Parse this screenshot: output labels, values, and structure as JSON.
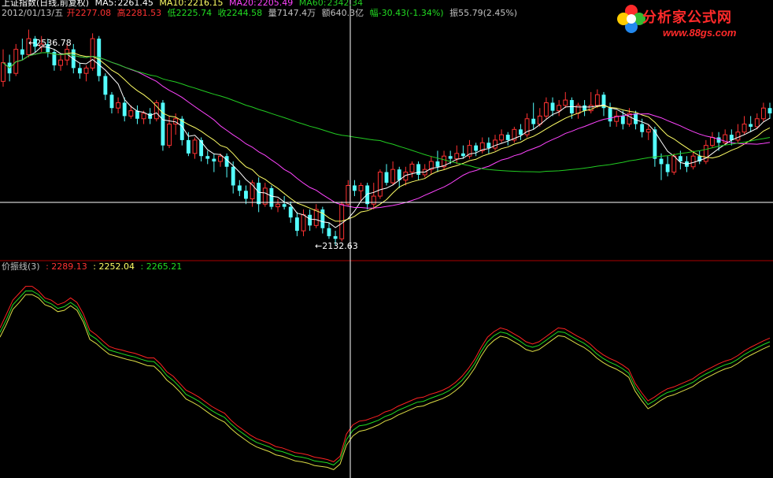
{
  "header": {
    "index_name": "上证指数",
    "period": "(日线,前复权)",
    "ma5_label": "MA5:",
    "ma5_value": "2261.45",
    "ma10_label": "MA10:",
    "ma10_value": "2216.15",
    "ma20_label": "MA20:",
    "ma20_value": "2205.49",
    "ma60_label": "MA60:",
    "ma60_value": "2342.34"
  },
  "info": {
    "date": "2012/01/13/五",
    "open_label": "开",
    "open_value": "2277.08",
    "high_label": "高",
    "high_value": "2281.53",
    "low_label": "低",
    "low_value": "2225.74",
    "close_label": "收",
    "close_value": "2244.58",
    "volume_label": "量",
    "volume_value": "7147.4万",
    "amount_label": "额",
    "amount_value": "640.3亿",
    "change_label": "幅",
    "change_value": "-30.43(-1.34%)",
    "amplitude_label": "振",
    "amplitude_value": "55.79(2.45%)"
  },
  "price_marks": {
    "high": "2536.78",
    "low": "2132.63"
  },
  "indicator": {
    "name": "价振线(3)",
    "v1": ": 2289.13",
    "v2": ": 2252.04",
    "v3": ": 2265.21"
  },
  "logo": {
    "text": "分析家公式网",
    "url": "www.88gs.com"
  },
  "colors": {
    "up": "#ff3232",
    "down": "#54ffff",
    "ma5": "#ffffff",
    "ma10": "#ffff66",
    "ma20": "#ff44ff",
    "ma60": "#22cc22",
    "line1": "#ff2222",
    "line2": "#22dd22",
    "line3": "#dddd44",
    "crosshair": "#ffffff",
    "divider": "#aa0000",
    "text": "#c0c0c0"
  },
  "chart_data": [
    {
      "type": "candlestick",
      "title": "上证指数 (日线,前复权)",
      "ylim": [
        2110,
        2560
      ],
      "extremes": {
        "high": 2536.78,
        "low": 2132.63
      },
      "ohlc": [
        [
          2440,
          2475,
          2500,
          2430
        ],
        [
          2475,
          2455,
          2490,
          2440
        ],
        [
          2455,
          2500,
          2510,
          2450
        ],
        [
          2500,
          2490,
          2520,
          2480
        ],
        [
          2490,
          2520,
          2537,
          2485
        ],
        [
          2520,
          2505,
          2525,
          2495
        ],
        [
          2505,
          2510,
          2525,
          2495
        ],
        [
          2510,
          2495,
          2520,
          2485
        ],
        [
          2495,
          2470,
          2500,
          2460
        ],
        [
          2470,
          2480,
          2490,
          2460
        ],
        [
          2480,
          2500,
          2510,
          2470
        ],
        [
          2500,
          2465,
          2510,
          2455
        ],
        [
          2465,
          2455,
          2475,
          2445
        ],
        [
          2455,
          2465,
          2470,
          2440
        ],
        [
          2465,
          2520,
          2530,
          2460
        ],
        [
          2520,
          2450,
          2525,
          2440
        ],
        [
          2450,
          2415,
          2455,
          2405
        ],
        [
          2415,
          2390,
          2420,
          2380
        ],
        [
          2390,
          2400,
          2410,
          2380
        ],
        [
          2400,
          2375,
          2410,
          2365
        ],
        [
          2375,
          2385,
          2395,
          2370
        ],
        [
          2385,
          2370,
          2395,
          2360
        ],
        [
          2370,
          2380,
          2385,
          2360
        ],
        [
          2380,
          2370,
          2390,
          2360
        ],
        [
          2370,
          2400,
          2405,
          2365
        ],
        [
          2400,
          2320,
          2405,
          2310
        ],
        [
          2320,
          2360,
          2375,
          2315
        ],
        [
          2360,
          2370,
          2380,
          2340
        ],
        [
          2370,
          2330,
          2375,
          2320
        ],
        [
          2330,
          2305,
          2345,
          2300
        ],
        [
          2305,
          2330,
          2335,
          2295
        ],
        [
          2330,
          2300,
          2335,
          2290
        ],
        [
          2300,
          2295,
          2310,
          2285
        ],
        [
          2295,
          2290,
          2305,
          2270
        ],
        [
          2290,
          2300,
          2305,
          2280
        ],
        [
          2300,
          2280,
          2305,
          2260
        ],
        [
          2280,
          2245,
          2290,
          2230
        ],
        [
          2245,
          2235,
          2255,
          2225
        ],
        [
          2235,
          2220,
          2245,
          2210
        ],
        [
          2220,
          2250,
          2255,
          2205
        ],
        [
          2250,
          2210,
          2260,
          2195
        ],
        [
          2210,
          2240,
          2250,
          2205
        ],
        [
          2240,
          2205,
          2245,
          2200
        ],
        [
          2205,
          2210,
          2220,
          2195
        ],
        [
          2210,
          2205,
          2225,
          2200
        ],
        [
          2205,
          2185,
          2215,
          2175
        ],
        [
          2185,
          2160,
          2195,
          2150
        ],
        [
          2160,
          2190,
          2200,
          2150
        ],
        [
          2190,
          2170,
          2200,
          2160
        ],
        [
          2170,
          2200,
          2210,
          2165
        ],
        [
          2200,
          2165,
          2205,
          2155
        ],
        [
          2165,
          2150,
          2175,
          2145
        ],
        [
          2150,
          2145,
          2160,
          2133
        ],
        [
          2145,
          2210,
          2215,
          2140
        ],
        [
          2210,
          2245,
          2255,
          2205
        ],
        [
          2245,
          2235,
          2255,
          2225
        ],
        [
          2235,
          2245,
          2250,
          2215
        ],
        [
          2245,
          2210,
          2250,
          2200
        ],
        [
          2210,
          2225,
          2250,
          2200
        ],
        [
          2225,
          2270,
          2275,
          2220
        ],
        [
          2270,
          2250,
          2285,
          2245
        ],
        [
          2250,
          2275,
          2290,
          2245
        ],
        [
          2275,
          2255,
          2280,
          2240
        ],
        [
          2255,
          2270,
          2280,
          2245
        ],
        [
          2270,
          2285,
          2290,
          2260
        ],
        [
          2285,
          2265,
          2290,
          2255
        ],
        [
          2265,
          2275,
          2285,
          2260
        ],
        [
          2275,
          2290,
          2300,
          2265
        ],
        [
          2290,
          2280,
          2310,
          2270
        ],
        [
          2280,
          2300,
          2310,
          2275
        ],
        [
          2300,
          2295,
          2310,
          2285
        ],
        [
          2295,
          2305,
          2320,
          2285
        ],
        [
          2305,
          2300,
          2320,
          2295
        ],
        [
          2300,
          2320,
          2330,
          2295
        ],
        [
          2320,
          2310,
          2325,
          2300
        ],
        [
          2310,
          2325,
          2335,
          2305
        ],
        [
          2325,
          2315,
          2335,
          2305
        ],
        [
          2315,
          2330,
          2340,
          2310
        ],
        [
          2330,
          2340,
          2350,
          2325
        ],
        [
          2340,
          2330,
          2345,
          2320
        ],
        [
          2330,
          2350,
          2355,
          2325
        ],
        [
          2350,
          2340,
          2360,
          2330
        ],
        [
          2340,
          2370,
          2380,
          2335
        ],
        [
          2370,
          2360,
          2400,
          2350
        ],
        [
          2360,
          2375,
          2390,
          2355
        ],
        [
          2375,
          2400,
          2410,
          2370
        ],
        [
          2400,
          2385,
          2410,
          2375
        ],
        [
          2385,
          2395,
          2405,
          2375
        ],
        [
          2395,
          2405,
          2420,
          2390
        ],
        [
          2405,
          2380,
          2410,
          2370
        ],
        [
          2380,
          2395,
          2400,
          2370
        ],
        [
          2395,
          2385,
          2405,
          2375
        ],
        [
          2385,
          2395,
          2420,
          2380
        ],
        [
          2395,
          2415,
          2425,
          2390
        ],
        [
          2415,
          2390,
          2420,
          2375
        ],
        [
          2390,
          2365,
          2400,
          2355
        ],
        [
          2365,
          2375,
          2385,
          2355
        ],
        [
          2375,
          2360,
          2385,
          2350
        ],
        [
          2360,
          2380,
          2390,
          2355
        ],
        [
          2380,
          2360,
          2385,
          2350
        ],
        [
          2360,
          2345,
          2370,
          2335
        ],
        [
          2345,
          2350,
          2360,
          2330
        ],
        [
          2350,
          2295,
          2355,
          2280
        ],
        [
          2295,
          2285,
          2305,
          2255
        ],
        [
          2285,
          2270,
          2300,
          2262
        ],
        [
          2270,
          2300,
          2305,
          2265
        ],
        [
          2300,
          2290,
          2310,
          2275
        ],
        [
          2290,
          2280,
          2300,
          2270
        ],
        [
          2280,
          2300,
          2310,
          2275
        ],
        [
          2300,
          2290,
          2310,
          2285
        ],
        [
          2290,
          2320,
          2330,
          2285
        ],
        [
          2320,
          2335,
          2345,
          2315
        ],
        [
          2335,
          2325,
          2345,
          2310
        ],
        [
          2325,
          2340,
          2350,
          2320
        ],
        [
          2340,
          2330,
          2350,
          2320
        ],
        [
          2330,
          2345,
          2360,
          2325
        ],
        [
          2345,
          2360,
          2375,
          2340
        ],
        [
          2360,
          2355,
          2375,
          2345
        ],
        [
          2355,
          2370,
          2380,
          2350
        ],
        [
          2370,
          2390,
          2400,
          2365
        ],
        [
          2390,
          2380,
          2400,
          2370
        ]
      ],
      "ma": [
        {
          "name": "MA5",
          "last": 2261.45
        },
        {
          "name": "MA10",
          "last": 2216.15
        },
        {
          "name": "MA20",
          "last": 2205.49
        },
        {
          "name": "MA60",
          "last": 2342.34
        }
      ]
    },
    {
      "type": "line",
      "title": "价振线(3)",
      "ylim": [
        2120,
        2560
      ],
      "series": [
        {
          "name": "1",
          "last": 2289.13,
          "values": [
            2440,
            2470,
            2500,
            2515,
            2530,
            2530,
            2520,
            2505,
            2500,
            2490,
            2495,
            2505,
            2495,
            2470,
            2435,
            2425,
            2412,
            2400,
            2395,
            2392,
            2388,
            2385,
            2380,
            2375,
            2375,
            2362,
            2345,
            2335,
            2320,
            2305,
            2298,
            2290,
            2280,
            2270,
            2262,
            2255,
            2240,
            2228,
            2218,
            2208,
            2200,
            2195,
            2190,
            2183,
            2180,
            2175,
            2170,
            2168,
            2165,
            2160,
            2158,
            2155,
            2150,
            2162,
            2210,
            2230,
            2238,
            2240,
            2245,
            2250,
            2258,
            2262,
            2270,
            2276,
            2282,
            2288,
            2290,
            2296,
            2300,
            2305,
            2312,
            2322,
            2335,
            2352,
            2372,
            2398,
            2420,
            2432,
            2440,
            2436,
            2428,
            2420,
            2410,
            2405,
            2410,
            2420,
            2430,
            2440,
            2438,
            2430,
            2422,
            2415,
            2405,
            2392,
            2382,
            2374,
            2368,
            2360,
            2350,
            2320,
            2300,
            2282,
            2290,
            2300,
            2308,
            2312,
            2318,
            2324,
            2330,
            2340,
            2348,
            2355,
            2362,
            2368,
            2372,
            2380,
            2390,
            2398,
            2405,
            2412,
            2418
          ]
        },
        {
          "name": "2",
          "last": 2252.04,
          "values": [
            2430,
            2458,
            2490,
            2505,
            2520,
            2520,
            2512,
            2498,
            2492,
            2482,
            2486,
            2495,
            2485,
            2460,
            2425,
            2416,
            2403,
            2392,
            2388,
            2384,
            2380,
            2377,
            2372,
            2368,
            2367,
            2354,
            2337,
            2326,
            2312,
            2296,
            2289,
            2281,
            2271,
            2261,
            2253,
            2246,
            2232,
            2220,
            2210,
            2200,
            2192,
            2187,
            2182,
            2175,
            2172,
            2167,
            2162,
            2160,
            2157,
            2152,
            2150,
            2148,
            2143,
            2155,
            2198,
            2218,
            2228,
            2230,
            2235,
            2240,
            2248,
            2253,
            2261,
            2267,
            2273,
            2279,
            2281,
            2287,
            2292,
            2297,
            2304,
            2314,
            2326,
            2343,
            2363,
            2389,
            2410,
            2423,
            2431,
            2428,
            2420,
            2412,
            2402,
            2398,
            2402,
            2412,
            2422,
            2432,
            2430,
            2422,
            2414,
            2407,
            2397,
            2384,
            2374,
            2366,
            2360,
            2352,
            2342,
            2312,
            2292,
            2274,
            2282,
            2292,
            2300,
            2304,
            2310,
            2316,
            2322,
            2332,
            2340,
            2347,
            2354,
            2360,
            2364,
            2372,
            2382,
            2390,
            2397,
            2404,
            2410
          ]
        },
        {
          "name": "3",
          "last": 2265.21,
          "values": [
            2420,
            2448,
            2480,
            2495,
            2512,
            2512,
            2505,
            2490,
            2485,
            2475,
            2478,
            2488,
            2478,
            2452,
            2415,
            2406,
            2394,
            2383,
            2379,
            2375,
            2371,
            2368,
            2363,
            2358,
            2357,
            2344,
            2327,
            2316,
            2302,
            2286,
            2279,
            2271,
            2261,
            2251,
            2243,
            2236,
            2222,
            2210,
            2200,
            2190,
            2182,
            2177,
            2172,
            2165,
            2162,
            2157,
            2152,
            2150,
            2147,
            2142,
            2140,
            2138,
            2133,
            2145,
            2186,
            2206,
            2216,
            2219,
            2224,
            2230,
            2238,
            2243,
            2251,
            2257,
            2263,
            2269,
            2271,
            2277,
            2282,
            2287,
            2294,
            2304,
            2316,
            2333,
            2353,
            2379,
            2400,
            2413,
            2422,
            2419,
            2411,
            2403,
            2393,
            2389,
            2393,
            2403,
            2413,
            2423,
            2421,
            2413,
            2405,
            2398,
            2388,
            2375,
            2365,
            2357,
            2351,
            2343,
            2333,
            2303,
            2283,
            2265,
            2273,
            2283,
            2291,
            2295,
            2301,
            2307,
            2313,
            2323,
            2331,
            2338,
            2345,
            2351,
            2355,
            2363,
            2373,
            2381,
            2388,
            2395,
            2401
          ]
        }
      ]
    }
  ]
}
